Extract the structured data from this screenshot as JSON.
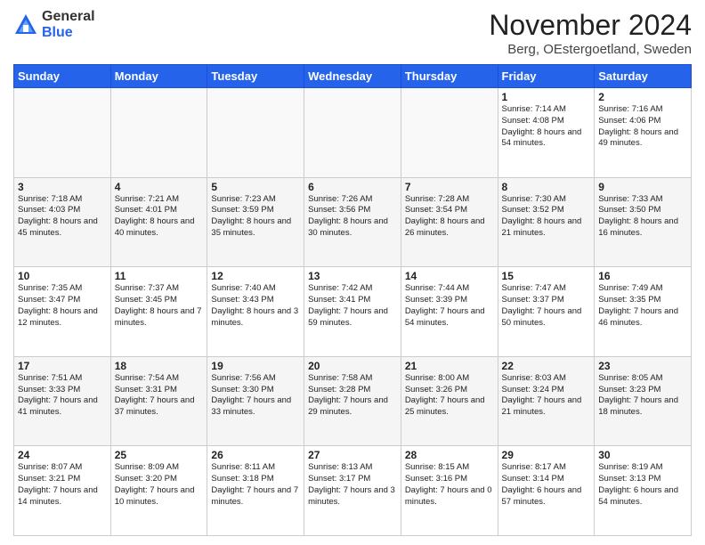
{
  "header": {
    "logo_general": "General",
    "logo_blue": "Blue",
    "month_title": "November 2024",
    "location": "Berg, OEstergoetland, Sweden"
  },
  "days_of_week": [
    "Sunday",
    "Monday",
    "Tuesday",
    "Wednesday",
    "Thursday",
    "Friday",
    "Saturday"
  ],
  "weeks": [
    [
      {
        "day": "",
        "info": ""
      },
      {
        "day": "",
        "info": ""
      },
      {
        "day": "",
        "info": ""
      },
      {
        "day": "",
        "info": ""
      },
      {
        "day": "",
        "info": ""
      },
      {
        "day": "1",
        "info": "Sunrise: 7:14 AM\nSunset: 4:08 PM\nDaylight: 8 hours and 54 minutes."
      },
      {
        "day": "2",
        "info": "Sunrise: 7:16 AM\nSunset: 4:06 PM\nDaylight: 8 hours and 49 minutes."
      }
    ],
    [
      {
        "day": "3",
        "info": "Sunrise: 7:18 AM\nSunset: 4:03 PM\nDaylight: 8 hours and 45 minutes."
      },
      {
        "day": "4",
        "info": "Sunrise: 7:21 AM\nSunset: 4:01 PM\nDaylight: 8 hours and 40 minutes."
      },
      {
        "day": "5",
        "info": "Sunrise: 7:23 AM\nSunset: 3:59 PM\nDaylight: 8 hours and 35 minutes."
      },
      {
        "day": "6",
        "info": "Sunrise: 7:26 AM\nSunset: 3:56 PM\nDaylight: 8 hours and 30 minutes."
      },
      {
        "day": "7",
        "info": "Sunrise: 7:28 AM\nSunset: 3:54 PM\nDaylight: 8 hours and 26 minutes."
      },
      {
        "day": "8",
        "info": "Sunrise: 7:30 AM\nSunset: 3:52 PM\nDaylight: 8 hours and 21 minutes."
      },
      {
        "day": "9",
        "info": "Sunrise: 7:33 AM\nSunset: 3:50 PM\nDaylight: 8 hours and 16 minutes."
      }
    ],
    [
      {
        "day": "10",
        "info": "Sunrise: 7:35 AM\nSunset: 3:47 PM\nDaylight: 8 hours and 12 minutes."
      },
      {
        "day": "11",
        "info": "Sunrise: 7:37 AM\nSunset: 3:45 PM\nDaylight: 8 hours and 7 minutes."
      },
      {
        "day": "12",
        "info": "Sunrise: 7:40 AM\nSunset: 3:43 PM\nDaylight: 8 hours and 3 minutes."
      },
      {
        "day": "13",
        "info": "Sunrise: 7:42 AM\nSunset: 3:41 PM\nDaylight: 7 hours and 59 minutes."
      },
      {
        "day": "14",
        "info": "Sunrise: 7:44 AM\nSunset: 3:39 PM\nDaylight: 7 hours and 54 minutes."
      },
      {
        "day": "15",
        "info": "Sunrise: 7:47 AM\nSunset: 3:37 PM\nDaylight: 7 hours and 50 minutes."
      },
      {
        "day": "16",
        "info": "Sunrise: 7:49 AM\nSunset: 3:35 PM\nDaylight: 7 hours and 46 minutes."
      }
    ],
    [
      {
        "day": "17",
        "info": "Sunrise: 7:51 AM\nSunset: 3:33 PM\nDaylight: 7 hours and 41 minutes."
      },
      {
        "day": "18",
        "info": "Sunrise: 7:54 AM\nSunset: 3:31 PM\nDaylight: 7 hours and 37 minutes."
      },
      {
        "day": "19",
        "info": "Sunrise: 7:56 AM\nSunset: 3:30 PM\nDaylight: 7 hours and 33 minutes."
      },
      {
        "day": "20",
        "info": "Sunrise: 7:58 AM\nSunset: 3:28 PM\nDaylight: 7 hours and 29 minutes."
      },
      {
        "day": "21",
        "info": "Sunrise: 8:00 AM\nSunset: 3:26 PM\nDaylight: 7 hours and 25 minutes."
      },
      {
        "day": "22",
        "info": "Sunrise: 8:03 AM\nSunset: 3:24 PM\nDaylight: 7 hours and 21 minutes."
      },
      {
        "day": "23",
        "info": "Sunrise: 8:05 AM\nSunset: 3:23 PM\nDaylight: 7 hours and 18 minutes."
      }
    ],
    [
      {
        "day": "24",
        "info": "Sunrise: 8:07 AM\nSunset: 3:21 PM\nDaylight: 7 hours and 14 minutes."
      },
      {
        "day": "25",
        "info": "Sunrise: 8:09 AM\nSunset: 3:20 PM\nDaylight: 7 hours and 10 minutes."
      },
      {
        "day": "26",
        "info": "Sunrise: 8:11 AM\nSunset: 3:18 PM\nDaylight: 7 hours and 7 minutes."
      },
      {
        "day": "27",
        "info": "Sunrise: 8:13 AM\nSunset: 3:17 PM\nDaylight: 7 hours and 3 minutes."
      },
      {
        "day": "28",
        "info": "Sunrise: 8:15 AM\nSunset: 3:16 PM\nDaylight: 7 hours and 0 minutes."
      },
      {
        "day": "29",
        "info": "Sunrise: 8:17 AM\nSunset: 3:14 PM\nDaylight: 6 hours and 57 minutes."
      },
      {
        "day": "30",
        "info": "Sunrise: 8:19 AM\nSunset: 3:13 PM\nDaylight: 6 hours and 54 minutes."
      }
    ]
  ]
}
